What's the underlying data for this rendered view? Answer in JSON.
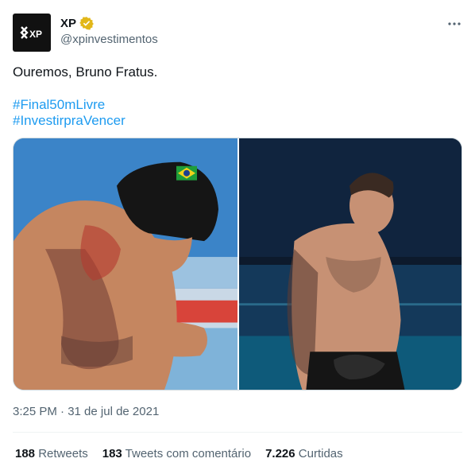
{
  "author": {
    "display_name": "XP",
    "handle": "@xpinvestimentos",
    "avatar_logo": "XP",
    "avatar_icon": "xp-logo",
    "verified_badge": "verified-badge-gold",
    "verified_color": "#e2b719"
  },
  "tweet": {
    "text": "Ouremos, Bruno Fratus.",
    "hashtags": [
      "#Final50mLivre",
      "#InvestirpraVencer"
    ],
    "link_color": "#1d9bf0"
  },
  "media": {
    "images": [
      {
        "subject": "swimmer-with-brazil-cap-looking-down"
      },
      {
        "subject": "swimmer-looking-up-poolside"
      }
    ]
  },
  "timestamp": "3:25 PM · 31 de jul de 2021",
  "stats": [
    {
      "count": "188",
      "label": "Retweets"
    },
    {
      "count": "183",
      "label": "Tweets com comentário"
    },
    {
      "count": "7.226",
      "label": "Curtidas"
    }
  ],
  "more_icon": "more-horizontal-icon"
}
